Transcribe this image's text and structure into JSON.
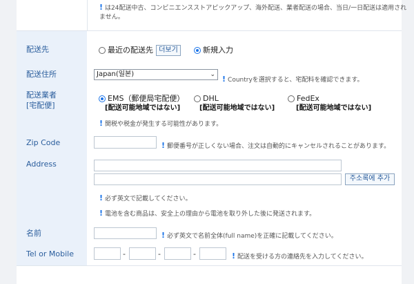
{
  "top_note": {
    "line1": "は24配送中古、コンビニエンスストアピックアップ、海外配送、業者配送の場合、当日/一日配送は適用され",
    "line2": "ません。"
  },
  "delivery_dest": {
    "label": "配送先",
    "option_recent": "最近の配送先",
    "more_button": "더보기",
    "option_new": "新規入力"
  },
  "delivery_address": {
    "label": "配送住所",
    "country_value": "Japan(일본)",
    "note": "Countryを選択すると、宅配料を確認できます。"
  },
  "carrier": {
    "label_line1": "配送業者",
    "label_line2": "[宅配便]",
    "options": [
      {
        "name": "EMS（郵便局宅配便）",
        "sub": "[配送可能地域ではない]"
      },
      {
        "name": "DHL",
        "sub": "[配送可能地域ではない]"
      },
      {
        "name": "FedEx",
        "sub": "[配送可能地域ではない]"
      }
    ],
    "note": "関税や税金が発生する可能性があります。"
  },
  "zip": {
    "label": "Zip Code",
    "note": "郵便番号が正しくない場合、注文は自動的にキャンセルされることがあります。"
  },
  "address": {
    "label": "Address",
    "add_button": "주소록에 추가",
    "note1": "必ず英文で記載してください。",
    "note2": "電池を含む商品は、安全上の理由から電池を取り外した後に発送されます。"
  },
  "name": {
    "label": "名前",
    "note": "必ず英文で名前全体(full name)を正確に記載してください。"
  },
  "tel": {
    "label": "Tel or Mobile",
    "note": "配送を受ける方の連絡先を入力してください。"
  }
}
